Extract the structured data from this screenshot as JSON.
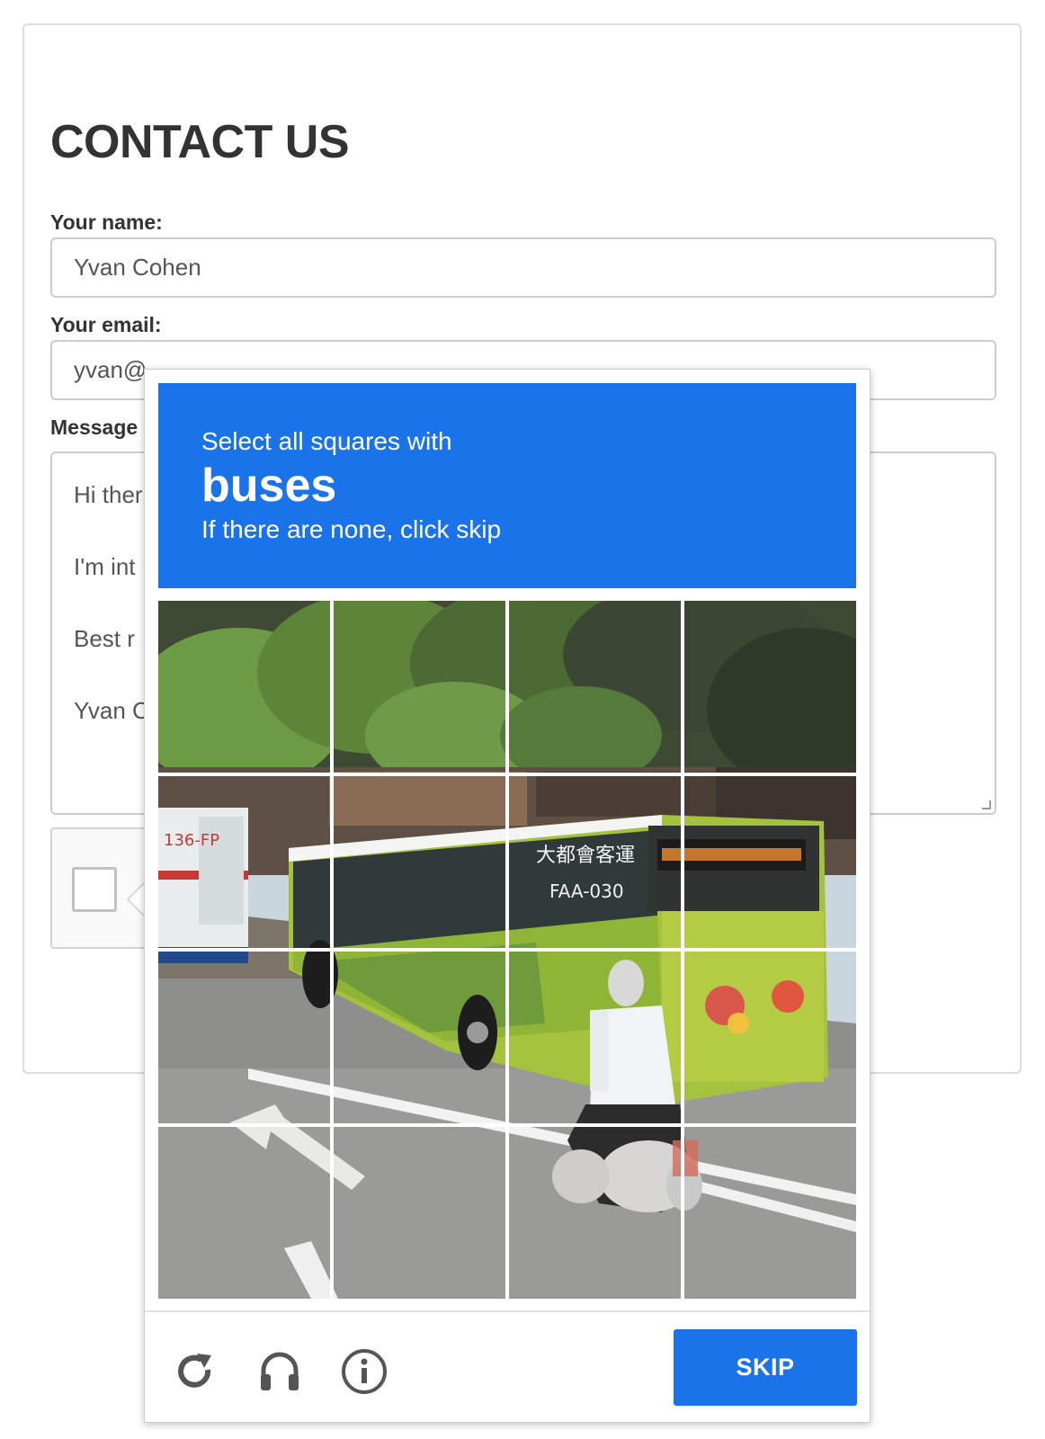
{
  "form": {
    "title": "CONTACT US",
    "name_label": "Your name:",
    "name_value": "Yvan Cohen",
    "email_label": "Your email:",
    "email_value": "yvan@",
    "message_label": "Message",
    "message_lines": [
      "Hi ther",
      "I'm int",
      "Best r",
      "Yvan C"
    ]
  },
  "challenge": {
    "intro": "Select all squares with",
    "target": "buses",
    "instruction": "If there are none, click skip",
    "grid_rows": 4,
    "grid_cols": 4,
    "skip_label": "SKIP",
    "footer_icons": [
      "reload-icon",
      "audio-headphones-icon",
      "info-icon"
    ],
    "image_text": {
      "left_bus_plate": "136-FP",
      "bus_chinese": "大都會客運",
      "bus_plate": "FAA-030"
    }
  },
  "colors": {
    "accent": "#1a73e8",
    "title_text": "#333333",
    "border": "#cccccc"
  }
}
